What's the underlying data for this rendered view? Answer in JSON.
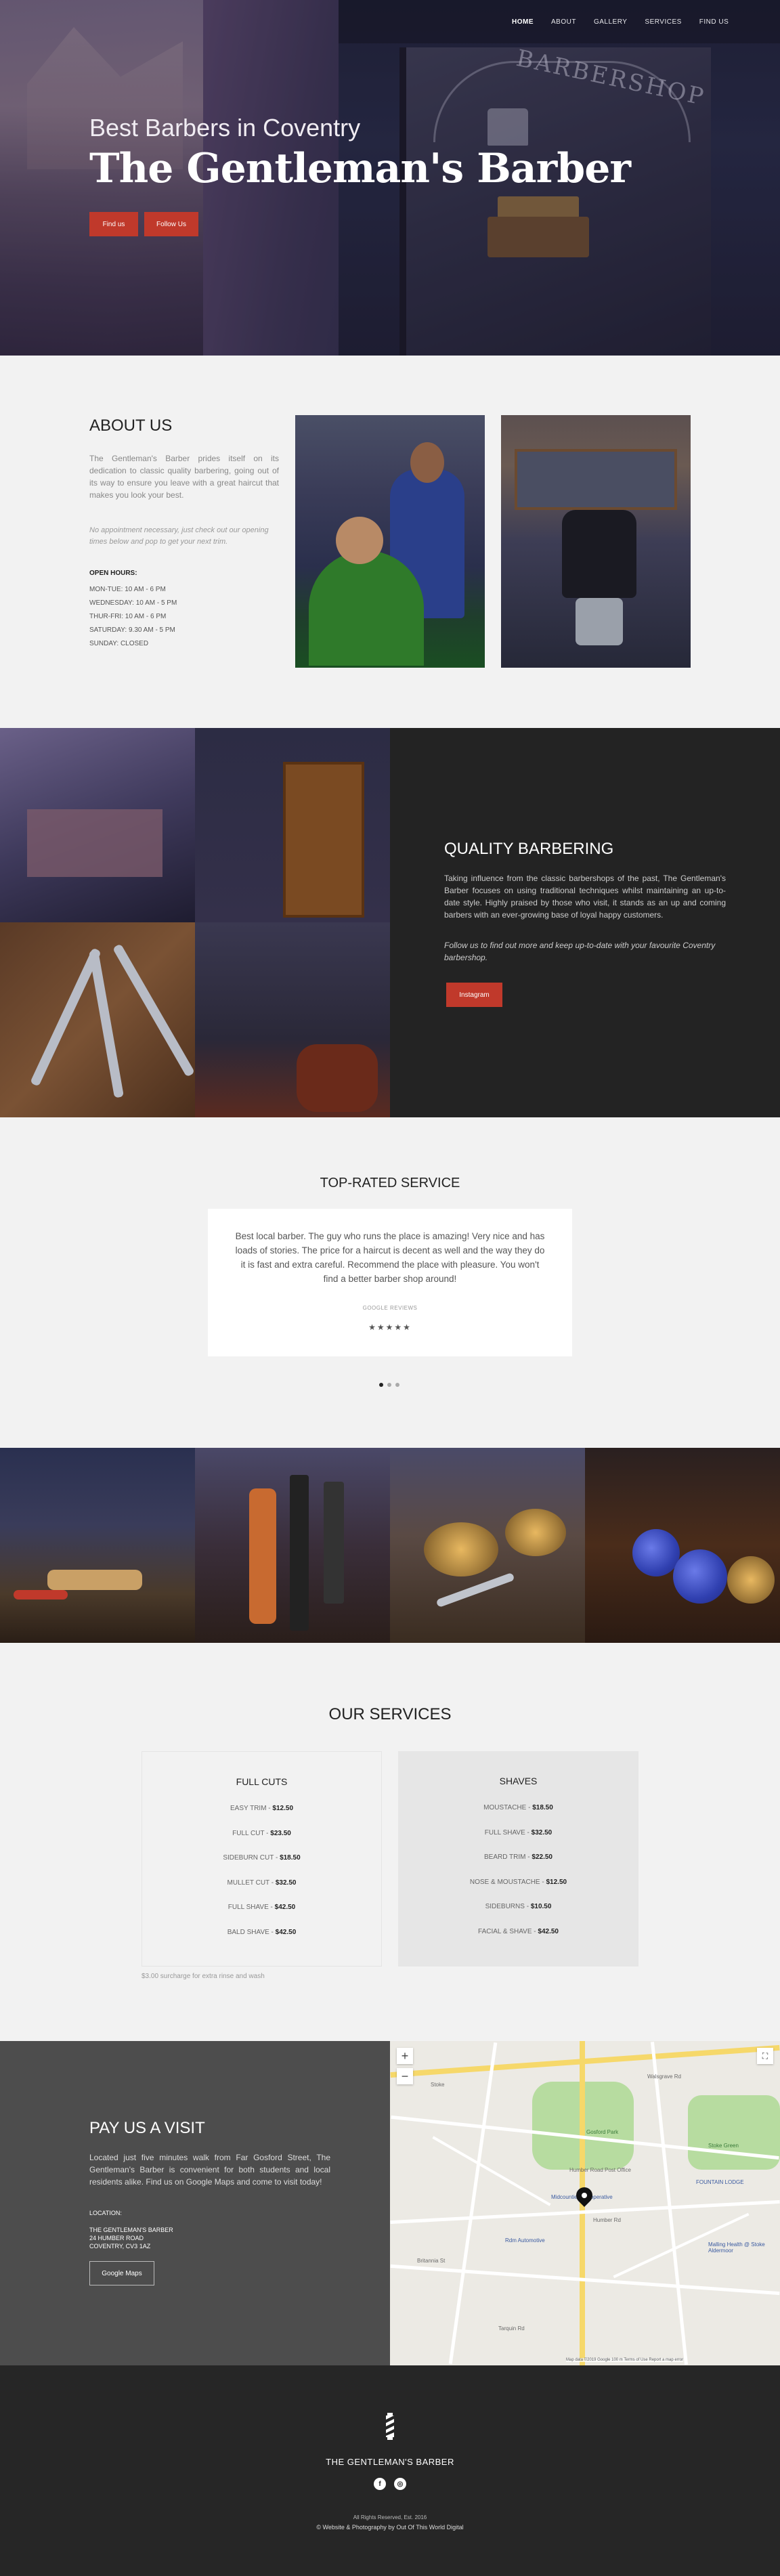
{
  "nav": {
    "items": [
      {
        "label": "HOME"
      },
      {
        "label": "ABOUT"
      },
      {
        "label": "GALLERY"
      },
      {
        "label": "SERVICES"
      },
      {
        "label": "FIND US"
      }
    ]
  },
  "hero": {
    "subtitle": "Best Barbers in Coventry",
    "title": "The Gentleman's Barber",
    "find_us_label": "Find us",
    "follow_us_label": "Follow Us",
    "sign_text": "BARBERSHOP"
  },
  "about": {
    "heading": "ABOUT US",
    "intro": "The Gentleman's Barber prides itself on its dedication to classic quality barbering, going out of its way to ensure you leave with a great haircut that makes you look your best.",
    "note": "No appointment necessary, just check out our opening times below and pop to get your next trim.",
    "hours_label": "OPEN HOURS:",
    "hours": [
      "MON-TUE: 10 AM - 6 PM",
      "WEDNESDAY: 10 AM - 5 PM",
      "THUR-FRI: 10 AM - 6 PM",
      "SATURDAY: 9.30 AM - 5 PM",
      "SUNDAY: CLOSED"
    ]
  },
  "quality": {
    "heading": "QUALITY BARBERING",
    "text": "Taking influence from the classic barbershops of the past, The Gentleman's Barber focuses on using traditional techniques whilst maintaining an up-to-date style. Highly praised by those who visit, it stands as an up and coming barbers with an ever-growing base of loyal happy customers.",
    "follow": "Follow us to find out more and keep up-to-date with your favourite Coventry barbershop.",
    "button": "Instagram"
  },
  "testimonial": {
    "heading": "TOP-RATED SERVICE",
    "quote": "Best local barber. The guy who runs the place is amazing! Very nice and has loads of stories. The price for a haircut is decent as well and the way they do it is fast and extra careful. Recommend the place with pleasure. You won't find a better barber shop around!",
    "source": "GOOGLE REVIEWS",
    "stars": "★★★★★",
    "rating": 5,
    "active_slide": 1,
    "slide_count": 3
  },
  "services": {
    "heading": "OUR SERVICES",
    "full_cuts": {
      "title": "FULL CUTS",
      "items": [
        {
          "name": "EASY TRIM",
          "price": "$12.50"
        },
        {
          "name": "FULL CUT",
          "price": "$23.50"
        },
        {
          "name": "SIDEBURN CUT",
          "price": "$18.50"
        },
        {
          "name": "MULLET CUT",
          "price": "$32.50"
        },
        {
          "name": "FULL SHAVE",
          "price": "$42.50"
        },
        {
          "name": "BALD SHAVE",
          "price": "$42.50"
        }
      ]
    },
    "shaves": {
      "title": "SHAVES",
      "items": [
        {
          "name": "MOUSTACHE",
          "price": "$18.50"
        },
        {
          "name": "FULL SHAVE",
          "price": "$32.50"
        },
        {
          "name": "BEARD TRIM",
          "price": "$22.50"
        },
        {
          "name": "NOSE & MOUSTACHE",
          "price": "$12.50"
        },
        {
          "name": "SIDEBURNS",
          "price": "$10.50"
        },
        {
          "name": "FACIAL & SHAVE",
          "price": "$42.50"
        }
      ]
    },
    "note": "$3.00 surcharge for extra rinse and wash"
  },
  "visit": {
    "heading": "PAY US A VISIT",
    "text": "Located just five minutes walk from Far Gosford Street, The Gentleman's Barber is convenient for both students and local residents alike. Find us on Google Maps and come to visit today!",
    "location_label": "LOCATION:",
    "address": [
      "THE GENTLEMAN'S BARBER",
      "24 HUMBER ROAD",
      "COVENTRY, CV3 1AZ"
    ],
    "button": "Google Maps"
  },
  "map": {
    "zoom_in": "+",
    "zoom_out": "−",
    "fullscreen": "⛶",
    "labels": {
      "gosford_park": "Gosford Park",
      "post_office": "Humber Road Post Office",
      "coop": "Midcounties Co-operative",
      "fountain": "FOUNTAIN LODGE",
      "stoke_green": "Stoke Green",
      "automotive": "Rdm Automotive",
      "walsgrave": "Walsgrave Rd",
      "humber": "Humber Rd",
      "stoke": "Stoke",
      "mallow": "Malling Health @ Stoke Aldermoor",
      "britannia": "Britannia St",
      "tar_road": "Tarquin Rd"
    },
    "attribution": "Map data ©2019 Google   100 m   Terms of Use   Report a map error"
  },
  "footer": {
    "brand": "THE GENTLEMAN'S BARBER",
    "social": [
      "f",
      "◎"
    ],
    "copyright": "All Rights Reserved, Est. 2016",
    "credit": "© Website & Photography by Out Of This World Digital"
  },
  "colors": {
    "accent": "#c0392b",
    "dark": "#232323",
    "visit_bg": "#4d4d4d",
    "footer_bg": "#262626",
    "light_bg": "#f2f2f2"
  }
}
